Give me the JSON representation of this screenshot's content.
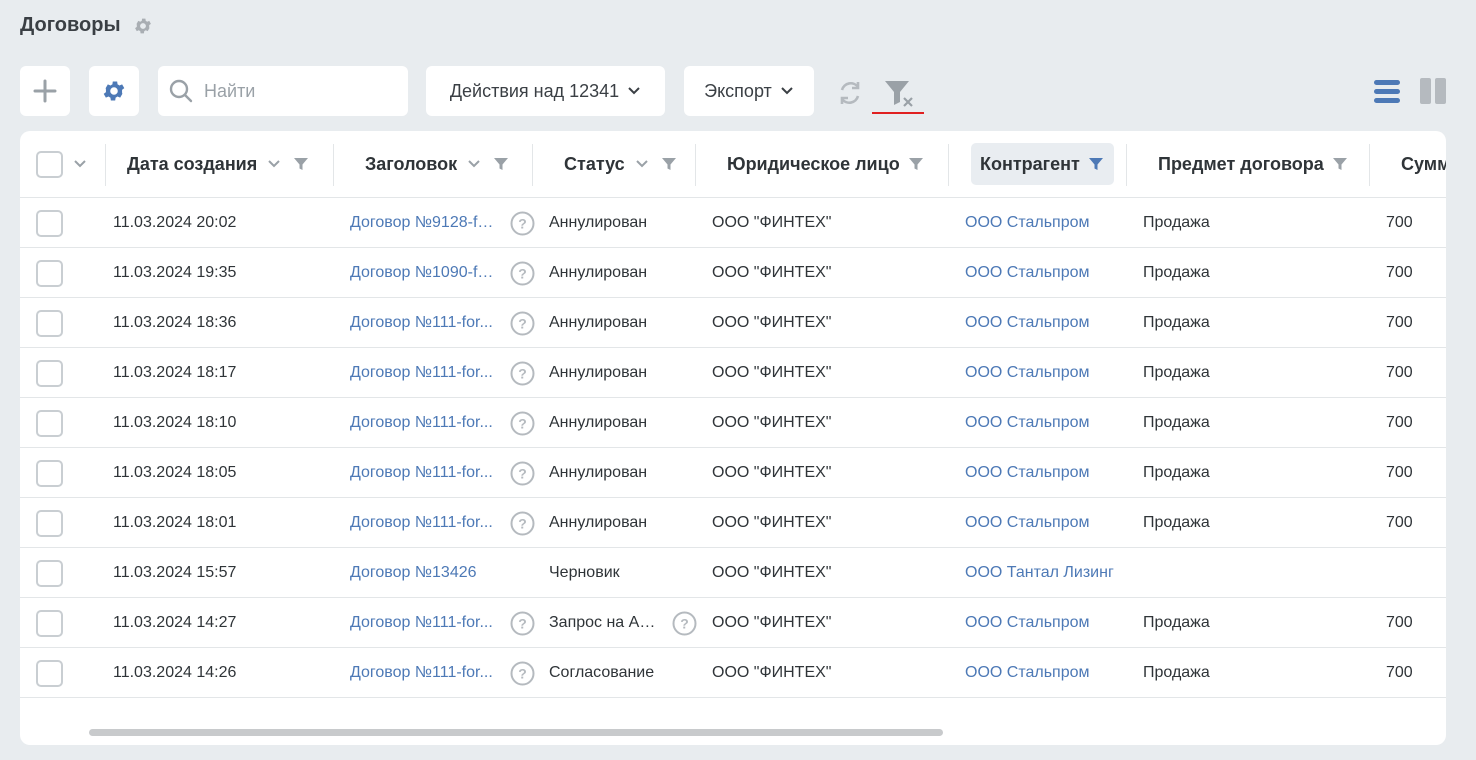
{
  "page": {
    "title": "Договоры"
  },
  "toolbar": {
    "search_placeholder": "Найти",
    "actions_label": "Действия над 12341",
    "export_label": "Экспорт"
  },
  "colors": {
    "accent": "#4d79b6",
    "background": "#e8ecef",
    "filter_clear_underline": "#e02020"
  },
  "icons": [
    "gear-icon",
    "plus-icon",
    "settings-gear-icon",
    "search-icon",
    "chevron-down-icon",
    "refresh-icon",
    "clear-filter-icon",
    "list-view-icon",
    "column-view-icon",
    "sort-chevron-icon",
    "filter-icon",
    "help-icon"
  ],
  "table": {
    "columns": [
      {
        "key": "created",
        "label": "Дата создания"
      },
      {
        "key": "title",
        "label": "Заголовок"
      },
      {
        "key": "status",
        "label": "Статус"
      },
      {
        "key": "legal",
        "label": "Юридическое лицо"
      },
      {
        "key": "counterparty",
        "label": "Контрагент"
      },
      {
        "key": "subject",
        "label": "Предмет договора"
      },
      {
        "key": "sum",
        "label": "Сумм"
      }
    ],
    "rows": [
      {
        "created": "11.03.2024 20:02",
        "title": "Договор №9128-fo...",
        "title_help": true,
        "status": "Аннулирован",
        "status_help": false,
        "legal": "ООО \"ФИНТЕХ\"",
        "counterparty": "ООО Стальпром",
        "subject": "Продажа",
        "sum": "700"
      },
      {
        "created": "11.03.2024 19:35",
        "title": "Договор №1090-fo...",
        "title_help": true,
        "status": "Аннулирован",
        "status_help": false,
        "legal": "ООО \"ФИНТЕХ\"",
        "counterparty": "ООО Стальпром",
        "subject": "Продажа",
        "sum": "700"
      },
      {
        "created": "11.03.2024 18:36",
        "title": "Договор №111-for...",
        "title_help": true,
        "status": "Аннулирован",
        "status_help": false,
        "legal": "ООО \"ФИНТЕХ\"",
        "counterparty": "ООО Стальпром",
        "subject": "Продажа",
        "sum": "700"
      },
      {
        "created": "11.03.2024 18:17",
        "title": "Договор №111-for...",
        "title_help": true,
        "status": "Аннулирован",
        "status_help": false,
        "legal": "ООО \"ФИНТЕХ\"",
        "counterparty": "ООО Стальпром",
        "subject": "Продажа",
        "sum": "700"
      },
      {
        "created": "11.03.2024 18:10",
        "title": "Договор №111-for...",
        "title_help": true,
        "status": "Аннулирован",
        "status_help": false,
        "legal": "ООО \"ФИНТЕХ\"",
        "counterparty": "ООО Стальпром",
        "subject": "Продажа",
        "sum": "700"
      },
      {
        "created": "11.03.2024 18:05",
        "title": "Договор №111-for...",
        "title_help": true,
        "status": "Аннулирован",
        "status_help": false,
        "legal": "ООО \"ФИНТЕХ\"",
        "counterparty": "ООО Стальпром",
        "subject": "Продажа",
        "sum": "700"
      },
      {
        "created": "11.03.2024 18:01",
        "title": "Договор №111-for...",
        "title_help": true,
        "status": "Аннулирован",
        "status_help": false,
        "legal": "ООО \"ФИНТЕХ\"",
        "counterparty": "ООО Стальпром",
        "subject": "Продажа",
        "sum": "700"
      },
      {
        "created": "11.03.2024 15:57",
        "title": "Договор №13426",
        "title_help": false,
        "status": "Черновик",
        "status_help": false,
        "legal": "ООО \"ФИНТЕХ\"",
        "counterparty": "ООО Тантал Лизинг",
        "subject": "",
        "sum": ""
      },
      {
        "created": "11.03.2024 14:27",
        "title": "Договор №111-for...",
        "title_help": true,
        "status": "Запрос на Ан...",
        "status_help": true,
        "legal": "ООО \"ФИНТЕХ\"",
        "counterparty": "ООО Стальпром",
        "subject": "Продажа",
        "sum": "700"
      },
      {
        "created": "11.03.2024 14:26",
        "title": "Договор №111-for...",
        "title_help": true,
        "status": "Согласование",
        "status_help": false,
        "legal": "ООО \"ФИНТЕХ\"",
        "counterparty": "ООО Стальпром",
        "subject": "Продажа",
        "sum": "700"
      }
    ]
  }
}
